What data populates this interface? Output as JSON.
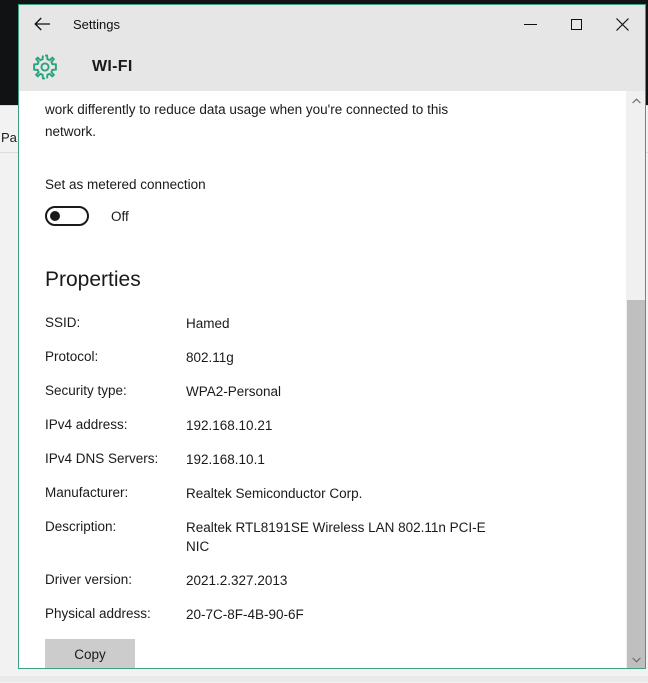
{
  "window": {
    "title": "Settings",
    "page_title": "WI-FI",
    "back_icon": "back-arrow-icon",
    "gear_icon": "gear-icon",
    "accent_color": "#3f9e84",
    "titlebar_color": "#e6e6e6",
    "controls": {
      "minimize_label": "Minimize",
      "maximize_label": "Maximize",
      "close_label": "Close"
    }
  },
  "background": {
    "partial_window_text": "Pa",
    "desktop_color": "#111214"
  },
  "main": {
    "intro_text": "work differently to reduce data usage when you're connected to this network.",
    "metered": {
      "label": "Set as metered connection",
      "state": "Off",
      "checked": false
    },
    "properties_heading": "Properties",
    "properties": [
      {
        "label": "SSID:",
        "value": "Hamed"
      },
      {
        "label": "Protocol:",
        "value": "802.11g"
      },
      {
        "label": "Security type:",
        "value": "WPA2-Personal"
      },
      {
        "label": "IPv4 address:",
        "value": "192.168.10.21"
      },
      {
        "label": "IPv4 DNS Servers:",
        "value": "192.168.10.1"
      },
      {
        "label": "Manufacturer:",
        "value": "Realtek Semiconductor Corp."
      },
      {
        "label": "Description:",
        "value": "Realtek RTL8191SE Wireless LAN 802.11n PCI-E NIC"
      },
      {
        "label": "Driver version:",
        "value": "2021.2.327.2013"
      },
      {
        "label": "Physical address:",
        "value": "20-7C-8F-4B-90-6F"
      }
    ],
    "copy_button_label": "Copy"
  },
  "scrollbar": {
    "up_arrow_icon": "chevron-up-icon",
    "down_arrow_icon": "chevron-down-icon",
    "thumb_color": "#bfbfbf",
    "track_color": "#f0f0f0"
  }
}
